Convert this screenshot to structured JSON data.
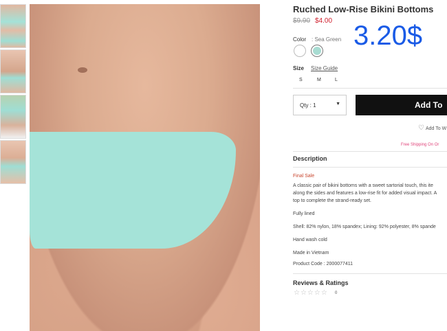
{
  "gallery": {
    "thumbnails": [
      "thumb-1",
      "thumb-2",
      "thumb-3",
      "thumb-4"
    ]
  },
  "product": {
    "title": "Ruched Low-Rise Bikini Bottoms",
    "old_price": "$9.90",
    "new_price": "$4.00",
    "overlay_price": "3.20$",
    "color_label": "Color",
    "color_value": ": Sea Green",
    "swatches": [
      {
        "name": "White",
        "color": "#ffffff"
      },
      {
        "name": "Sea Green",
        "color": "#a8dcd2"
      }
    ],
    "size_label": "Size",
    "size_guide": "Size Guide",
    "sizes": [
      "S",
      "M",
      "L"
    ],
    "qty_label": "Qty : 1",
    "add_button": "Add To",
    "wishlist": "Add To W",
    "shipping": "Free Shipping On Or",
    "description_heading": "Description",
    "final_sale": "Final Sale",
    "description_lines": [
      "A classic pair of bikini bottoms with a sweet sartorial touch, this ite",
      "along the sides and features a low-rise fit for added visual impact. A",
      "top to complete the strand-ready set."
    ],
    "details": [
      "Fully lined",
      "Shell: 82% nylon, 18% spandex; Lining: 92% polyester, 8% spande",
      "Hand wash cold",
      "Made in Vietnam",
      "Product Code : 2000077411"
    ],
    "reviews_heading": "Reviews & Ratings",
    "stars": "☆☆☆☆☆",
    "review_count": "0"
  }
}
